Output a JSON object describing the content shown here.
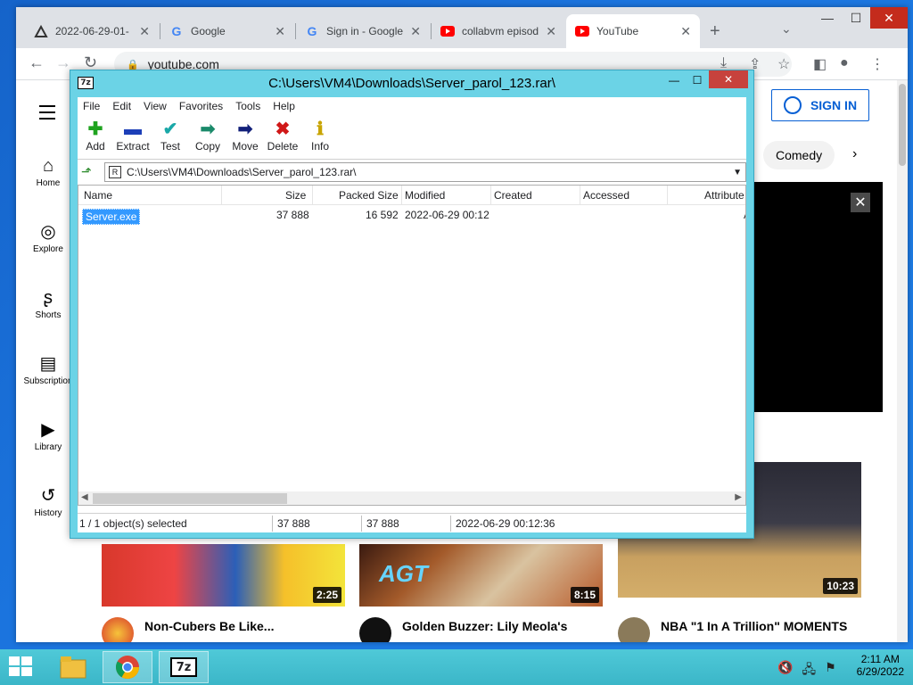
{
  "chrome": {
    "tabs": [
      {
        "title": "2022-06-29-01-",
        "icon": "collabvm-icon"
      },
      {
        "title": "Google",
        "icon": "google-icon"
      },
      {
        "title": "Sign in - Google",
        "icon": "google-icon"
      },
      {
        "title": "collabvm episod",
        "icon": "youtube-icon"
      },
      {
        "title": "YouTube",
        "icon": "youtube-icon"
      }
    ],
    "url": "youtube.com"
  },
  "youtube": {
    "sign_in": "SIGN IN",
    "nav": [
      "Home",
      "Explore",
      "Shorts",
      "Subscription",
      "Library",
      "History"
    ],
    "chip": "Comedy",
    "videos": [
      {
        "title": "Non-Cubers Be Like...",
        "duration": "2:25"
      },
      {
        "title": "Golden Buzzer: Lily Meola's",
        "duration": "8:15",
        "thumb_text": "AGT"
      },
      {
        "title": "NBA \"1 In A Trillion\" MOMENTS",
        "duration": "10:23"
      }
    ]
  },
  "sevenzip": {
    "title": "C:\\Users\\VM4\\Downloads\\Server_parol_123.rar\\",
    "app_icon": "7z",
    "menu": [
      "File",
      "Edit",
      "View",
      "Favorites",
      "Tools",
      "Help"
    ],
    "tools": [
      "Add",
      "Extract",
      "Test",
      "Copy",
      "Move",
      "Delete",
      "Info"
    ],
    "path": "C:\\Users\\VM4\\Downloads\\Server_parol_123.rar\\",
    "columns": [
      "Name",
      "Size",
      "Packed Size",
      "Modified",
      "Created",
      "Accessed",
      "Attribute"
    ],
    "files": [
      {
        "name": "Server.exe",
        "size": "37 888",
        "packed": "16 592",
        "modified": "2022-06-29 00:12",
        "attr": "A"
      }
    ],
    "status": {
      "selection": "1 / 1 object(s) selected",
      "size": "37 888",
      "packed": "37 888",
      "modified": "2022-06-29 00:12:36"
    }
  },
  "taskbar": {
    "app_7z": "7z",
    "time": "2:11 AM",
    "date": "6/29/2022"
  }
}
